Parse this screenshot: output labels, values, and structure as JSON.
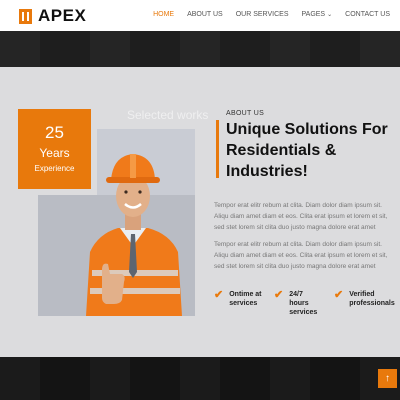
{
  "brand": {
    "name": "APEX",
    "accent": "#e8790c"
  },
  "nav": {
    "items": [
      {
        "label": "HOME",
        "active": true
      },
      {
        "label": "ABOUT US",
        "active": false
      },
      {
        "label": "OUR SERVICES",
        "active": false
      },
      {
        "label": "PAGES",
        "active": false,
        "dropdown": true
      },
      {
        "label": "CONTACT US",
        "active": false
      }
    ]
  },
  "hero_ghost": {
    "text": "Selected works"
  },
  "experience": {
    "number": "25",
    "unit": "Years",
    "label": "Experience"
  },
  "about": {
    "label": "ABOUT US",
    "headline": "Unique Solutions For Residentials & Industries!",
    "paragraphs": [
      "Tempor erat elitr rebum at clita. Diam dolor diam ipsum sit. Aliqu diam amet diam et eos. Clita erat ipsum et lorem et sit, sed stet lorem sit clita duo justo magna dolore erat amet",
      "Tempor erat elitr rebum at clita. Diam dolor diam ipsum sit. Aliqu diam amet diam et eos. Clita erat ipsum et lorem et sit, sed stet lorem sit clita duo justo magna dolore erat amet"
    ],
    "features": [
      {
        "label": "Ontime at services"
      },
      {
        "label": "24/7 hours services"
      },
      {
        "label": "Verified professionals"
      }
    ]
  },
  "icons": {
    "logo": "building-logo-icon",
    "check": "check-icon",
    "back_to_top": "arrow-up-icon",
    "dropdown": "chevron-down-icon"
  }
}
